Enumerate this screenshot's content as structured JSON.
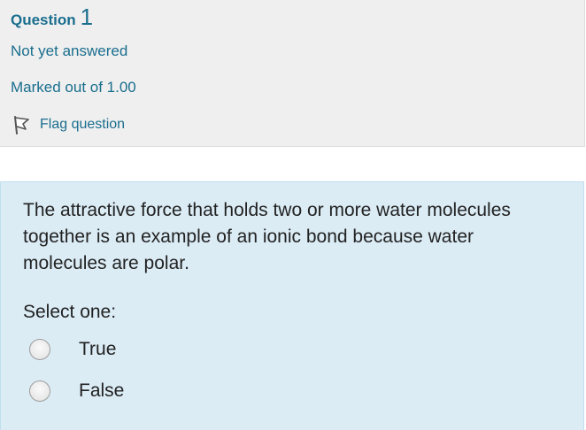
{
  "info": {
    "question_word": "Question",
    "question_number": "1",
    "state": "Not yet answered",
    "grade": "Marked out of 1.00",
    "flag_label": "Flag question",
    "flag_icon": "flag-icon"
  },
  "question": {
    "text": "The attractive force that holds two or more water molecules together is an example of an ionic bond because water molecules are polar.",
    "prompt": "Select one:",
    "options": [
      {
        "label": "True",
        "selected": false
      },
      {
        "label": "False",
        "selected": false
      }
    ]
  },
  "colors": {
    "accent_text": "#1a6e8e",
    "info_background": "#efefef",
    "content_background": "#dbecf5"
  }
}
